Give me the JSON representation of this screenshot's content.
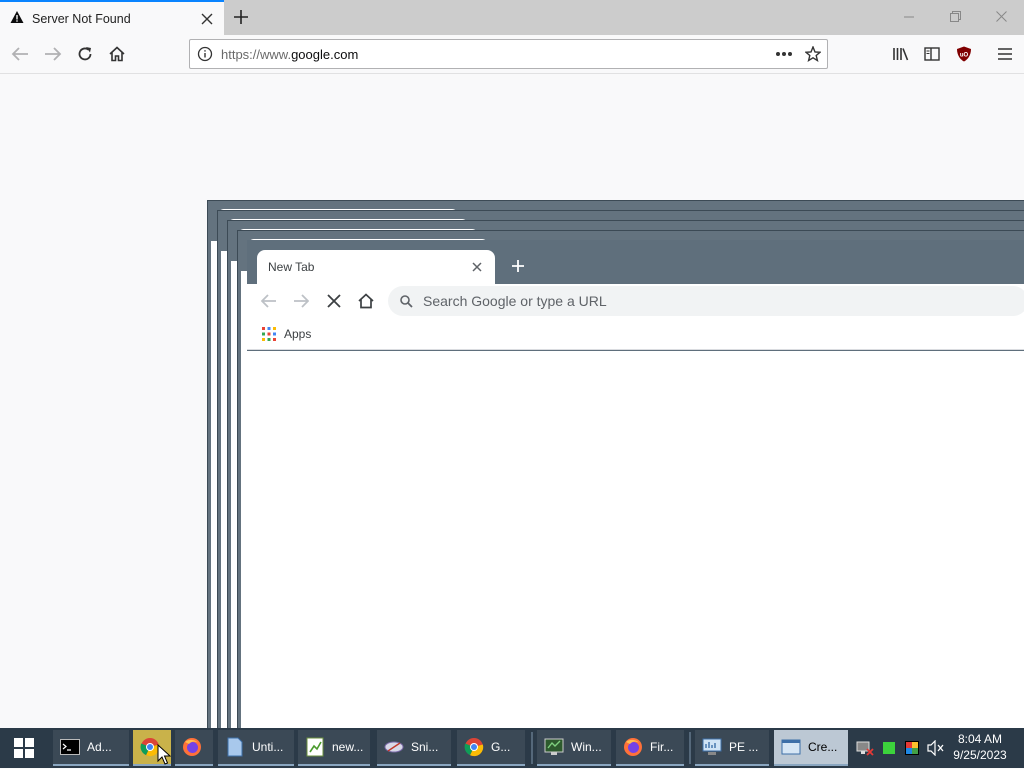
{
  "firefox": {
    "tab_title": "Server Not Found",
    "url_prefix": "https://www.",
    "url_host": "google.com",
    "icons": [
      "warning-icon",
      "close-icon",
      "plus-icon",
      "minimize-icon",
      "restore-icon",
      "back-icon",
      "forward-icon",
      "reload-icon",
      "home-icon",
      "info-icon",
      "more-icon",
      "star-icon",
      "library-icon",
      "sidebar-icon",
      "ublock-icon",
      "menu-icon"
    ]
  },
  "chrome": {
    "tab_title": "New Tab",
    "omnibox_placeholder": "Search Google or type a URL",
    "bookmark_apps": "Apps"
  },
  "taskbar": {
    "items": [
      {
        "label": "Ad...",
        "icon": "terminal-icon"
      },
      {
        "label": "",
        "icon": "chrome-icon"
      },
      {
        "label": "",
        "icon": "firefox-icon"
      },
      {
        "label": "Unti...",
        "icon": "document-icon"
      },
      {
        "label": "new...",
        "icon": "spreadsheet-icon"
      },
      {
        "label": "Sni...",
        "icon": "snipping-icon"
      },
      {
        "label": "G...",
        "icon": "chrome-icon"
      },
      {
        "label": "Win...",
        "icon": "console-icon"
      },
      {
        "label": "Fir...",
        "icon": "firefox-icon"
      },
      {
        "label": "PE ...",
        "icon": "monitor-icon"
      },
      {
        "label": "Cre...",
        "icon": "window-icon"
      }
    ],
    "clock_time": "8:04 AM",
    "clock_date": "9/25/2023"
  },
  "colors": {
    "firefox_accent": "#0a84ff",
    "chrome_frame": "#5f6f7c",
    "taskbar": "#2b3a48"
  }
}
